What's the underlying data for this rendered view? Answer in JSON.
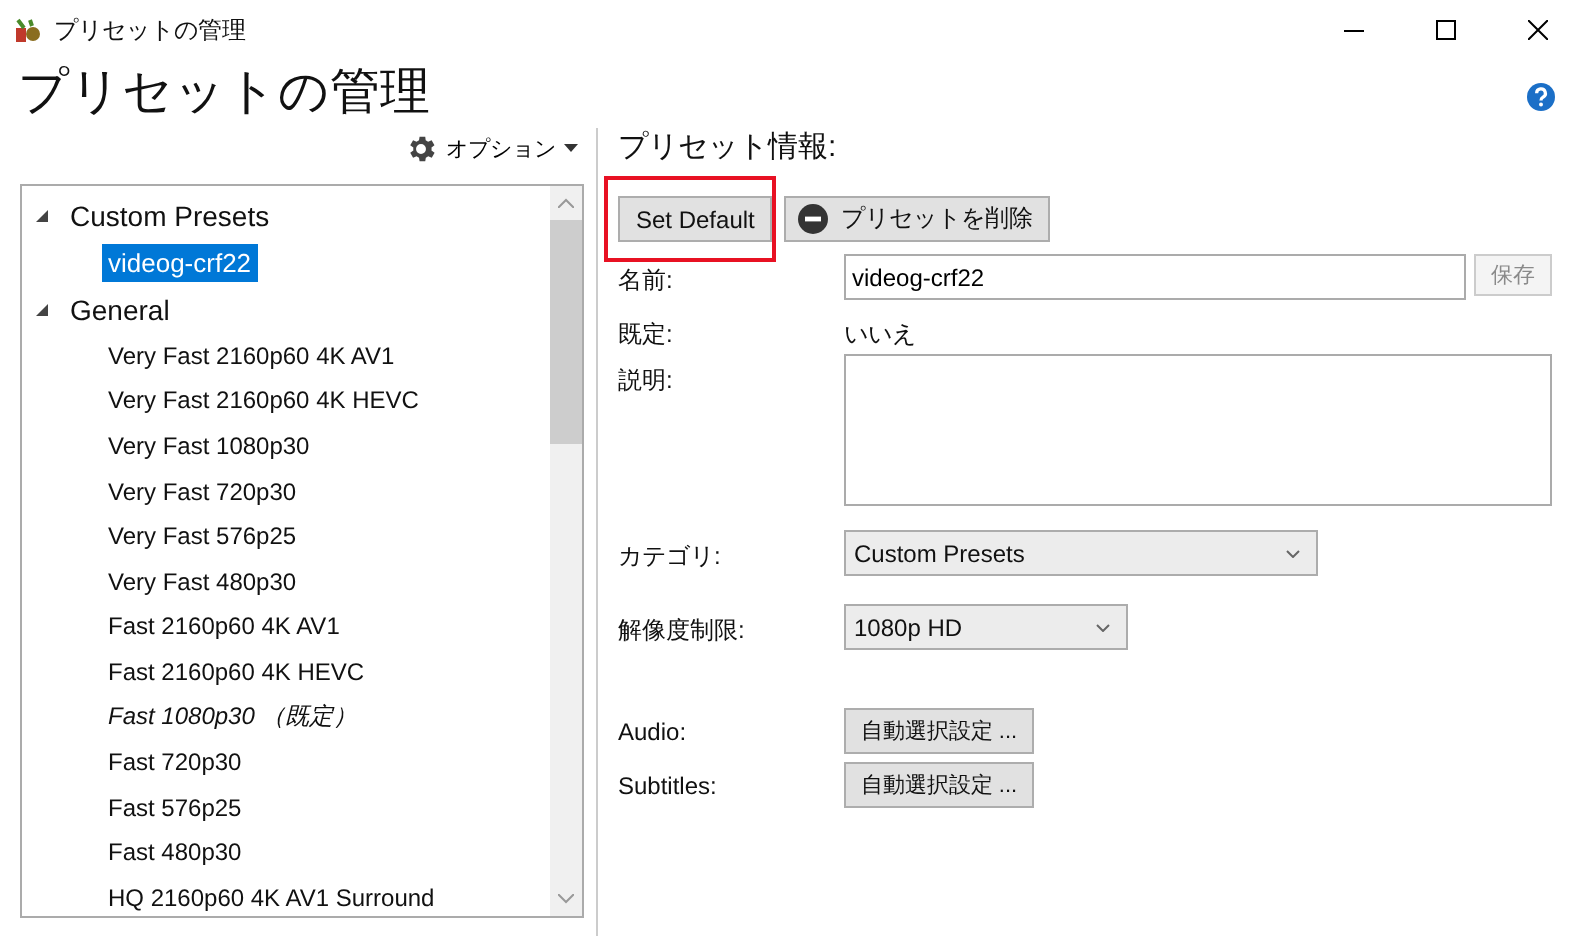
{
  "window": {
    "title": "プリセットの管理"
  },
  "heading": "プリセットの管理",
  "options_menu": {
    "label": "オプション"
  },
  "tree": [
    {
      "label": "Custom Presets",
      "expanded": true,
      "children": [
        {
          "label": "videog-crf22",
          "selected": true,
          "default": false
        }
      ]
    },
    {
      "label": "General",
      "expanded": true,
      "children": [
        {
          "label": "Very Fast 2160p60 4K AV1",
          "selected": false,
          "default": false
        },
        {
          "label": "Very Fast 2160p60 4K HEVC",
          "selected": false,
          "default": false
        },
        {
          "label": "Very Fast 1080p30",
          "selected": false,
          "default": false
        },
        {
          "label": "Very Fast 720p30",
          "selected": false,
          "default": false
        },
        {
          "label": "Very Fast 576p25",
          "selected": false,
          "default": false
        },
        {
          "label": "Very Fast 480p30",
          "selected": false,
          "default": false
        },
        {
          "label": "Fast 2160p60 4K AV1",
          "selected": false,
          "default": false
        },
        {
          "label": "Fast 2160p60 4K HEVC",
          "selected": false,
          "default": false
        },
        {
          "label": "Fast 1080p30 （既定）",
          "selected": false,
          "default": true
        },
        {
          "label": "Fast 720p30",
          "selected": false,
          "default": false
        },
        {
          "label": "Fast 576p25",
          "selected": false,
          "default": false
        },
        {
          "label": "Fast 480p30",
          "selected": false,
          "default": false
        },
        {
          "label": "HQ 2160p60 4K AV1 Surround",
          "selected": false,
          "default": false
        }
      ]
    }
  ],
  "info": {
    "title": "プリセット情報:",
    "set_default_button": {
      "label": "Set Default",
      "highlighted": true
    },
    "delete_button": {
      "label": "プリセットを削除"
    },
    "name": {
      "label": "名前:",
      "value": "videog-crf22"
    },
    "save_button": {
      "label": "保存",
      "disabled": true
    },
    "default": {
      "label": "既定:",
      "value": "いいえ"
    },
    "description": {
      "label": "説明:"
    },
    "category": {
      "label": "カテゴリ:",
      "value": "Custom Presets"
    },
    "resolution": {
      "label": "解像度制限:",
      "value": "1080p HD"
    },
    "audio": {
      "label": "Audio:",
      "button": "自動選択設定 ..."
    },
    "subtitles": {
      "label": "Subtitles:",
      "button": "自動選択設定 ..."
    }
  }
}
